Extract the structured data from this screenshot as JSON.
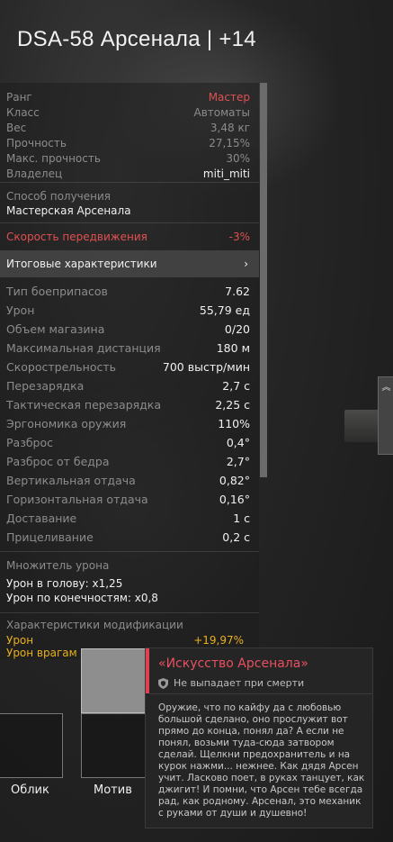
{
  "title": "DSA-58 Арсенала | +14",
  "info": [
    {
      "label": "Ранг",
      "value": "Мастер",
      "color": "#e05050"
    },
    {
      "label": "Класс",
      "value": "Автоматы",
      "color": "#8c8c8c"
    },
    {
      "label": "Вес",
      "value": "3,48 кг",
      "color": "#8c8c8c"
    },
    {
      "label": "Прочность",
      "value": "27,15%",
      "color": "#8c8c8c"
    },
    {
      "label": "Макс. прочность",
      "value": "30%",
      "color": "#8c8c8c"
    },
    {
      "label": "Владелец",
      "value": "miti_miti",
      "color": "#f0f0f0"
    }
  ],
  "acquisition": {
    "label": "Способ получения",
    "value": "Мастерская Арсенала"
  },
  "move_speed": {
    "label": "Скорость передвижения",
    "value": "-3%"
  },
  "totals_header": {
    "label": "Итоговые характеристики",
    "chevron": "›"
  },
  "stats": [
    {
      "label": "Тип боеприпасов",
      "value": "7.62"
    },
    {
      "label": "Урон",
      "value": "55,79 ед"
    },
    {
      "label": "Объем магазина",
      "value": "0/20"
    },
    {
      "label": "Максимальная дистанция",
      "value": "180 м"
    },
    {
      "label": "Скорострельность",
      "value": "700 выстр/мин"
    },
    {
      "label": "Перезарядка",
      "value": "2,7 с"
    },
    {
      "label": "Тактическая перезарядка",
      "value": "2,25 с"
    },
    {
      "label": "Эргономика оружия",
      "value": "110%"
    },
    {
      "label": "Разброс",
      "value": "0,4°"
    },
    {
      "label": "Разброс от бедра",
      "value": "2,7°"
    },
    {
      "label": "Вертикальная отдача",
      "value": "0,82°"
    },
    {
      "label": "Горизонтальная отдача",
      "value": "0,16°"
    },
    {
      "label": "Доставание",
      "value": "1 с"
    },
    {
      "label": "Прицеливание",
      "value": "0,2 с"
    }
  ],
  "damage_mult": {
    "label": "Множитель урона",
    "head": "Урон в голову: x1,25",
    "limbs": "Урон по конечностям: x0,8"
  },
  "mods": {
    "label": "Характеристики модификации",
    "row1_label": "Урон",
    "row1_value": "+19,97%",
    "row2_label": "Урон врагам"
  },
  "slots": {
    "look": "Облик",
    "motive": "Мотив"
  },
  "tooltip": {
    "title": "«Искусство Арсенала»",
    "subtitle": "Не выпадает при смерти",
    "description": "Оружие, что по кайфу да с любовью большой сделано, оно прослужит вот прямо до конца, понял да? А если не понял, возьми туда-сюда затвором сделай. Щелкни предохранитель и на курок нажми... нежнее. Как дядя Арсен учит. Ласково поет, в руках танцует, как джигит! И помни, что Арсен тебе всегда рад, как родному. Арсенал, это механик с руками от души и душевно!"
  },
  "colors": {
    "accent_red": "#e05050",
    "mod_yellow": "#e8b020",
    "tooltip_accent": "#e04050"
  },
  "icons": {
    "shield": "shield-icon",
    "chevron": "chevron-right-icon",
    "scroll": "double-chevron-up-icon"
  }
}
